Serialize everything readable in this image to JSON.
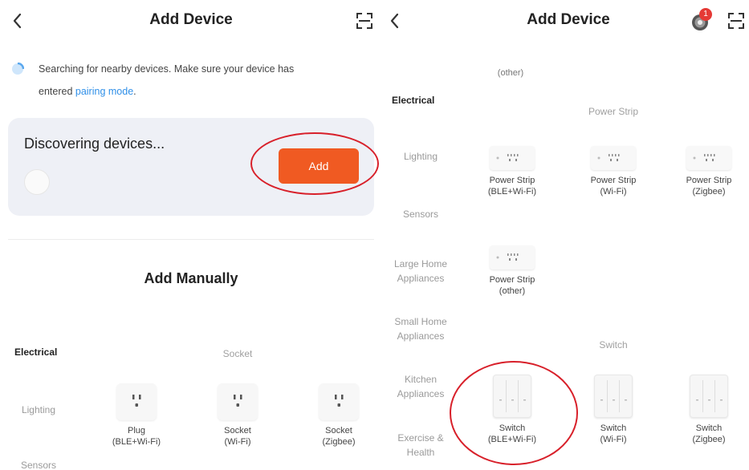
{
  "left_screen": {
    "title": "Add Device",
    "search_message_line1": "Searching for nearby devices. Make sure your device has",
    "search_message_prefix": "entered ",
    "pairing_mode_link": "pairing mode",
    "search_message_suffix": ".",
    "discovering_title": "Discovering devices...",
    "add_button_label": "Add",
    "add_manually_heading": "Add Manually",
    "categories": [
      "Electrical",
      "Lighting",
      "Sensors"
    ],
    "group_title": "Socket",
    "devices": [
      {
        "line1": "Plug",
        "line2": "(BLE+Wi-Fi)"
      },
      {
        "line1": "Socket",
        "line2": "(Wi-Fi)"
      },
      {
        "line1": "Socket",
        "line2": "(Zigbee)"
      }
    ]
  },
  "right_screen": {
    "title": "Add Device",
    "notification_count": "1",
    "top_cut_label": "(other)",
    "categories": [
      {
        "line1": "Electrical",
        "line2": ""
      },
      {
        "line1": "Lighting",
        "line2": ""
      },
      {
        "line1": "Sensors",
        "line2": ""
      },
      {
        "line1": "Large Home",
        "line2": "Appliances"
      },
      {
        "line1": "Small Home",
        "line2": "Appliances"
      },
      {
        "line1": "Kitchen",
        "line2": "Appliances"
      },
      {
        "line1": "Exercise &",
        "line2": "Health"
      }
    ],
    "power_strip_group": "Power Strip",
    "power_strips": [
      {
        "line1": "Power Strip",
        "line2": "(BLE+Wi-Fi)"
      },
      {
        "line1": "Power Strip",
        "line2": "(Wi-Fi)"
      },
      {
        "line1": "Power Strip",
        "line2": "(Zigbee)"
      },
      {
        "line1": "Power Strip",
        "line2": "(other)"
      }
    ],
    "switch_group": "Switch",
    "switches": [
      {
        "line1": "Switch",
        "line2": "(BLE+Wi-Fi)"
      },
      {
        "line1": "Switch",
        "line2": "(Wi-Fi)"
      },
      {
        "line1": "Switch",
        "line2": "(Zigbee)"
      }
    ]
  },
  "colors": {
    "accent_orange": "#f05a22",
    "link_blue": "#2f8fe8",
    "annotation_red": "#d8202a",
    "card_bg": "#eef0f6"
  },
  "icons": {
    "back": "chevron-left-icon",
    "scan": "scan-frame-icon",
    "search_spinner": "spinner-icon",
    "notification": "target-notification-icon"
  }
}
